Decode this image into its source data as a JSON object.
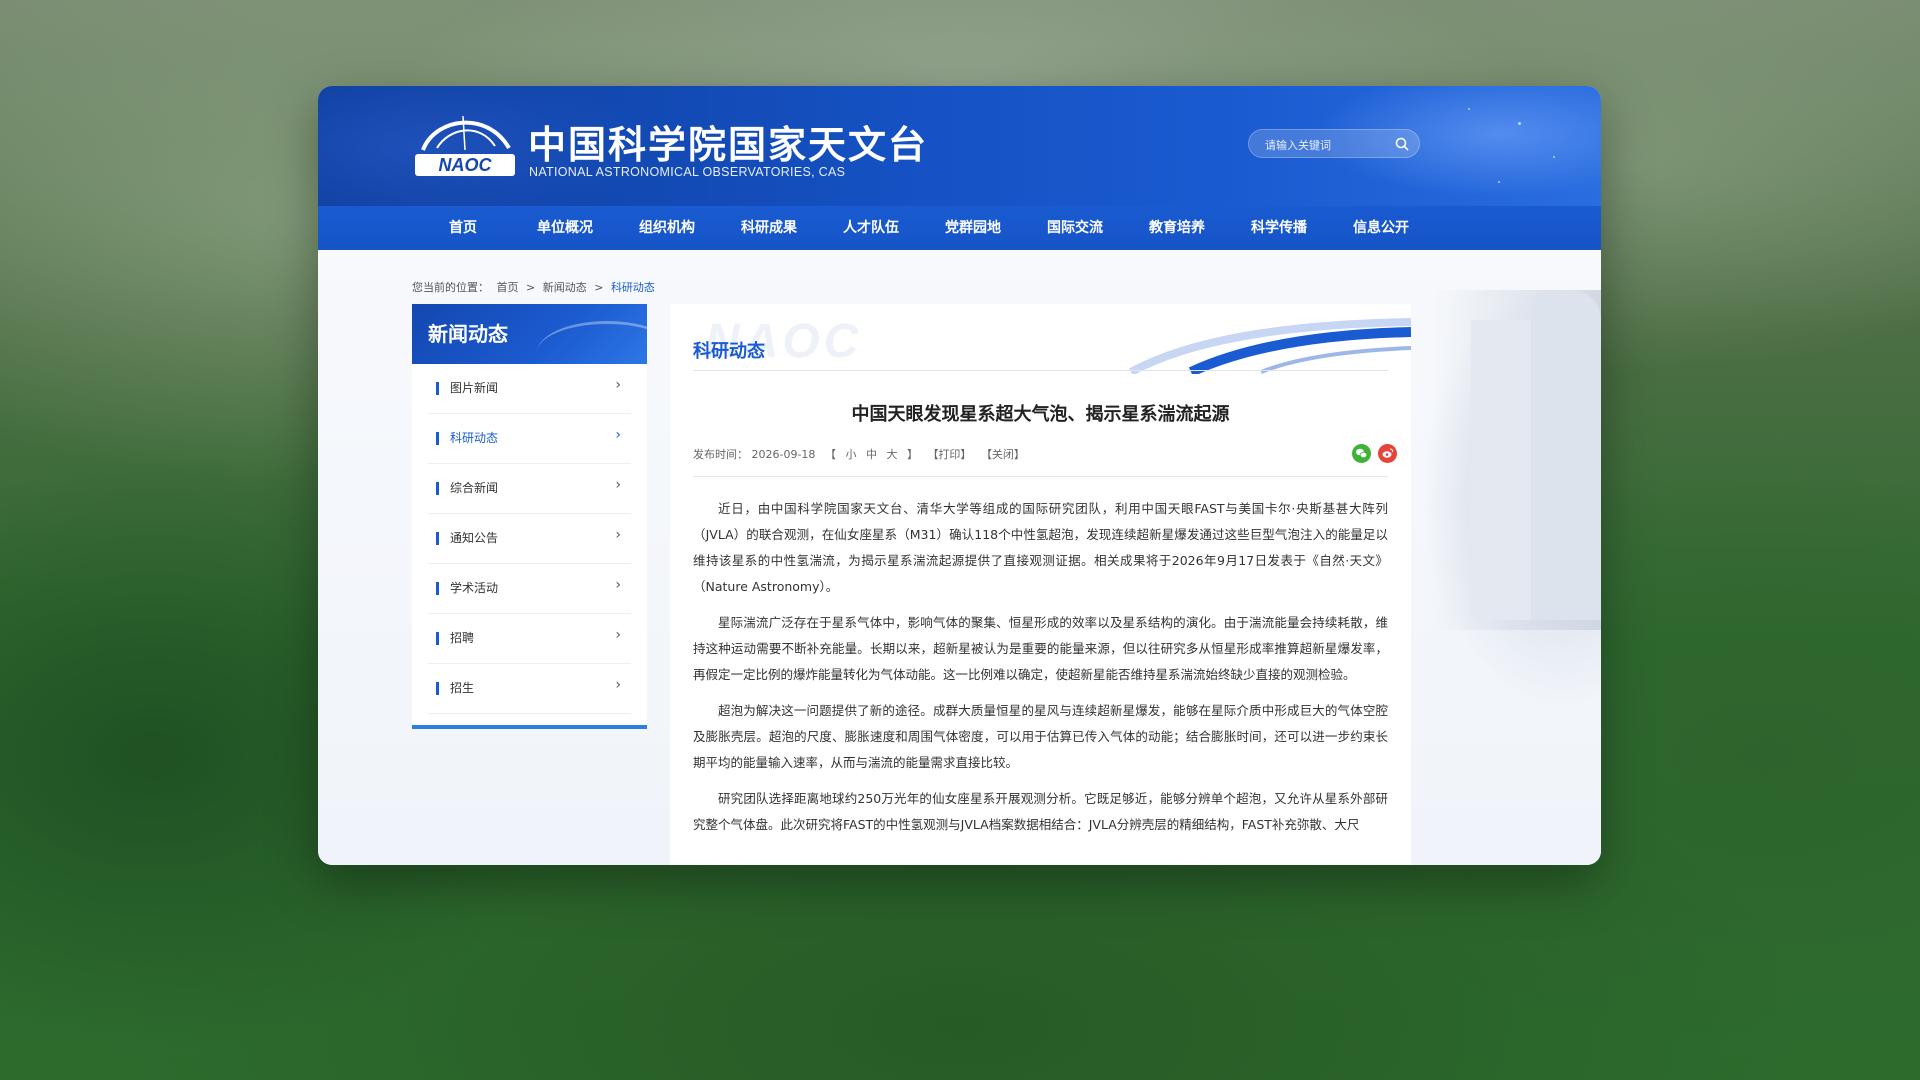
{
  "site": {
    "title_cn": "中国科学院国家天文台",
    "title_en": "NATIONAL ASTRONOMICAL OBSERVATORIES, CAS",
    "logo_text": "NAOC"
  },
  "search": {
    "placeholder": "请输入关键词",
    "icon": "search-icon"
  },
  "nav": {
    "items": [
      "首页",
      "单位概况",
      "组织机构",
      "科研成果",
      "人才队伍",
      "党群园地",
      "国际交流",
      "教育培养",
      "科学传播",
      "信息公开"
    ]
  },
  "breadcrumb": {
    "prefix": "您当前的位置：",
    "items": [
      "首页",
      "新闻动态",
      "科研动态"
    ],
    "separator": ">"
  },
  "sidebar": {
    "title": "新闻动态",
    "items": [
      {
        "label": "图片新闻",
        "active": false
      },
      {
        "label": "科研动态",
        "active": true
      },
      {
        "label": "综合新闻",
        "active": false
      },
      {
        "label": "通知公告",
        "active": false
      },
      {
        "label": "学术活动",
        "active": false
      },
      {
        "label": "招聘",
        "active": false
      },
      {
        "label": "招生",
        "active": false
      }
    ],
    "chevron": "›"
  },
  "article": {
    "section_label": "科研动态",
    "watermark": "NAOC",
    "title": "中国天眼发现星系超大气泡、揭示星系湍流起源",
    "meta": {
      "date_label": "发布时间：",
      "date": "2026-09-18",
      "font_sizes_prefix": "【",
      "font_small": "小",
      "font_medium": "中",
      "font_large": "大",
      "font_sizes_suffix": "】",
      "print": "【打印】",
      "close": "【关闭】"
    },
    "share": {
      "wechat": "wechat-icon",
      "weibo": "weibo-icon"
    },
    "paragraphs": [
      "近日，由中国科学院国家天文台、清华大学等组成的国际研究团队，利用中国天眼FAST与美国卡尔·央斯基甚大阵列（JVLA）的联合观测，在仙女座星系（M31）确认118个中性氢超泡，发现连续超新星爆发通过这些巨型气泡注入的能量足以维持该星系的中性氢湍流，为揭示星系湍流起源提供了直接观测证据。相关成果将于2026年9月17日发表于《自然·天文》（Nature Astronomy）。",
      "星际湍流广泛存在于星系气体中，影响气体的聚集、恒星形成的效率以及星系结构的演化。由于湍流能量会持续耗散，维持这种运动需要不断补充能量。长期以来，超新星被认为是重要的能量来源，但以往研究多从恒星形成率推算超新星爆发率，再假定一定比例的爆炸能量转化为气体动能。这一比例难以确定，使超新星能否维持星系湍流始终缺少直接的观测检验。",
      "超泡为解决这一问题提供了新的途径。成群大质量恒星的星风与连续超新星爆发，能够在星际介质中形成巨大的气体空腔及膨胀壳层。超泡的尺度、膨胀速度和周围气体密度，可以用于估算已传入气体的动能；结合膨胀时间，还可以进一步约束长期平均的能量输入速率，从而与湍流的能量需求直接比较。",
      "研究团队选择距离地球约250万光年的仙女座星系开展观测分析。它既足够近，能够分辨单个超泡，又允许从星系外部研究整个气体盘。此次研究将FAST的中性氢观测与JVLA档案数据相结合：JVLA分辨壳层的精细结构，FAST补充弥散、大尺"
    ]
  },
  "colors": {
    "brand_blue": "#1a5bd1",
    "header_dark": "#0f3f9f",
    "wechat_green": "#3fb337",
    "weibo_red": "#e6433b"
  }
}
